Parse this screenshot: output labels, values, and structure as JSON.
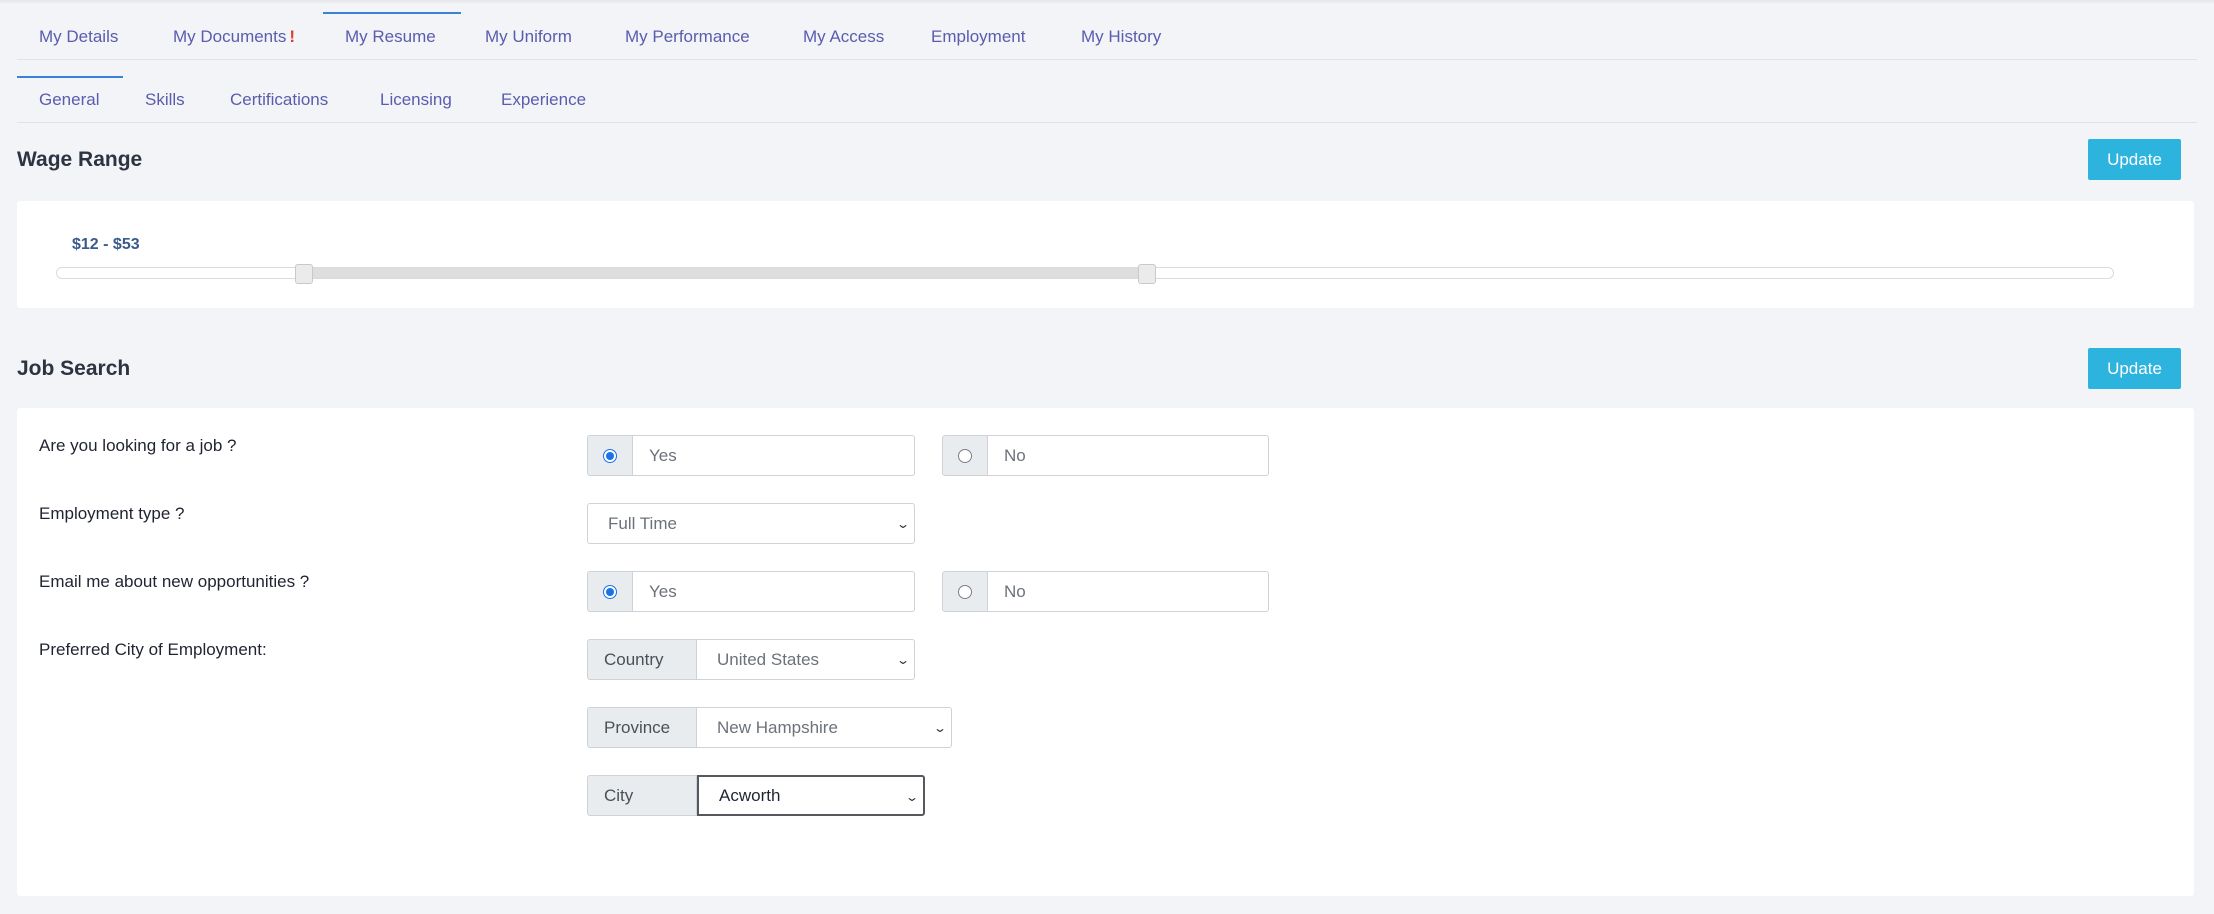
{
  "main_tabs": [
    {
      "label": "My Details"
    },
    {
      "label": "My Documents",
      "alert": "!"
    },
    {
      "label": "My Resume"
    },
    {
      "label": "My Uniform"
    },
    {
      "label": "My Performance"
    },
    {
      "label": "My Access"
    },
    {
      "label": "Employment"
    },
    {
      "label": "My History"
    }
  ],
  "sub_tabs": [
    "General",
    "Skills",
    "Certifications",
    "Licensing",
    "Experience"
  ],
  "wage": {
    "title": "Wage Range",
    "update_label": "Update",
    "range_label": "$12 - $53",
    "min_value": 12,
    "max_value": 53,
    "low_fraction": 0.12,
    "high_fraction": 0.53
  },
  "job_search": {
    "title": "Job Search",
    "update_label": "Update",
    "looking": {
      "question": "Are you looking for a job ?",
      "yes": "Yes",
      "no": "No",
      "selected": "Yes"
    },
    "employment_type": {
      "question": "Employment type ?",
      "value": "Full Time"
    },
    "email": {
      "question": "Email me about new opportunities ?",
      "yes": "Yes",
      "no": "No",
      "selected": "Yes"
    },
    "city": {
      "question": "Preferred City of Employment:",
      "country_label": "Country",
      "country_value": "United States",
      "province_label": "Province",
      "province_value": "New Hampshire",
      "city_label": "City",
      "city_value": "Acworth"
    }
  },
  "colors": {
    "accent": "#2cb4de",
    "tab_text": "#5a5cae",
    "active_border": "#3b82d6",
    "alert": "#e53935"
  }
}
